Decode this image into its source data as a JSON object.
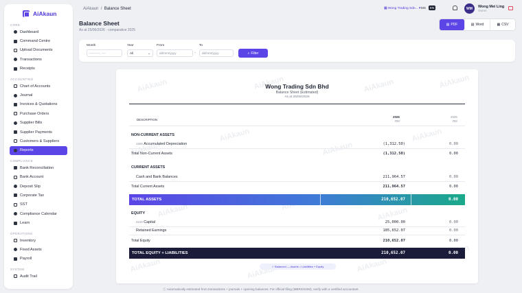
{
  "app": {
    "brand": "AiAkaun"
  },
  "sidebar": {
    "sections": [
      {
        "title": "CORE",
        "items": [
          "Dashboard",
          "Command Centre",
          "Upload Documents",
          "Transactions",
          "Receipts"
        ]
      },
      {
        "title": "ACCOUNTING",
        "items": [
          "Chart of Accounts",
          "Journal",
          "Invoices & Quotations",
          "Purchase Orders",
          "Supplier Bills",
          "Supplier Payments",
          "Customers & Suppliers",
          "Reports"
        ]
      },
      {
        "title": "COMPLIANCE",
        "items": [
          "Bank Reconciliation",
          "Bank Account",
          "Deposit Slip",
          "Corporate Tax",
          "SST",
          "Compliance Calendar",
          "Learn"
        ]
      },
      {
        "title": "OPERATIONS",
        "items": [
          "Inventory",
          "Fixed Assets",
          "Payroll"
        ]
      },
      {
        "title": "SYSTEM",
        "items": [
          "Audit Trail"
        ]
      }
    ],
    "active": "Reports"
  },
  "topbar": {
    "breadcrumb_root": "AiAkaun",
    "breadcrumb_sep": "/",
    "breadcrumb_current": "Balance Sheet",
    "company": "Wong Trading Sdn...",
    "lang_ms": "MS",
    "lang_en": "EN",
    "avatar_initials": "WM",
    "user_name": "Wong Mei Ling",
    "user_role": "Owner"
  },
  "page": {
    "title": "Balance Sheet",
    "subtitle": "As at 25/06/2026 · comparative 2025"
  },
  "export": {
    "pdf": "PDF",
    "word": "Word",
    "csv": "CSV"
  },
  "filter": {
    "month_label": "Month",
    "month_value": "----------, ----",
    "year_label": "Year",
    "year_value": "All",
    "from_label": "From",
    "from_value": "dd/mm/yyyy",
    "to_label": "To",
    "to_value": "dd/mm/yyyy",
    "range_sep": "–",
    "button": "Filter"
  },
  "report": {
    "watermark": "AiAkaun",
    "company": "Wong Trading Sdn Bhd",
    "name": "Balance Sheet (Estimated)",
    "date": "As at 25/06/2026",
    "col_desc": "DESCRIPTION",
    "col_cur_year": "2026",
    "col_cur_unit": "RM",
    "col_prev_year": "2025",
    "col_prev_unit": "RM",
    "nca_title": "NON-CURRENT ASSETS",
    "nca_row": {
      "code": "1508",
      "label": "Accumulated Depreciation",
      "cur": "(1,312.50)",
      "prev": "0.00"
    },
    "nca_total": {
      "label": "Total Non-Current Assets",
      "cur": "(1,312.50)",
      "prev": "0.00"
    },
    "ca_title": "CURRENT ASSETS",
    "ca_row": {
      "label": "Cash and Bank Balances",
      "cur": "211,964.57",
      "prev": "0.00"
    },
    "ca_total": {
      "label": "Total Current Assets",
      "cur": "211,964.57",
      "prev": "0.00"
    },
    "total_assets": {
      "label": "TOTAL ASSETS",
      "cur": "210,652.07",
      "prev": "0.00"
    },
    "eq_title": "EQUITY",
    "eq_row1": {
      "code": "3100",
      "label": "Capital",
      "cur": "25,000.00",
      "prev": "0.00"
    },
    "eq_row2": {
      "label": "Retained Earnings",
      "cur": "185,652.07",
      "prev": "0.00"
    },
    "eq_total": {
      "label": "Total Equity",
      "cur": "210,652.07",
      "prev": "0.00"
    },
    "total_eq_liab": {
      "label": "TOTAL EQUITY + LIABILITIES",
      "cur": "210,652.07",
      "prev": "0.00"
    },
    "balanced": "✓ Balanced — Assets = Liabilities + Equity"
  },
  "footnote": "Automatically estimated from transactions + journals + opening balances. For official filing (MBRS/SSM), verify with a certified accountant."
}
